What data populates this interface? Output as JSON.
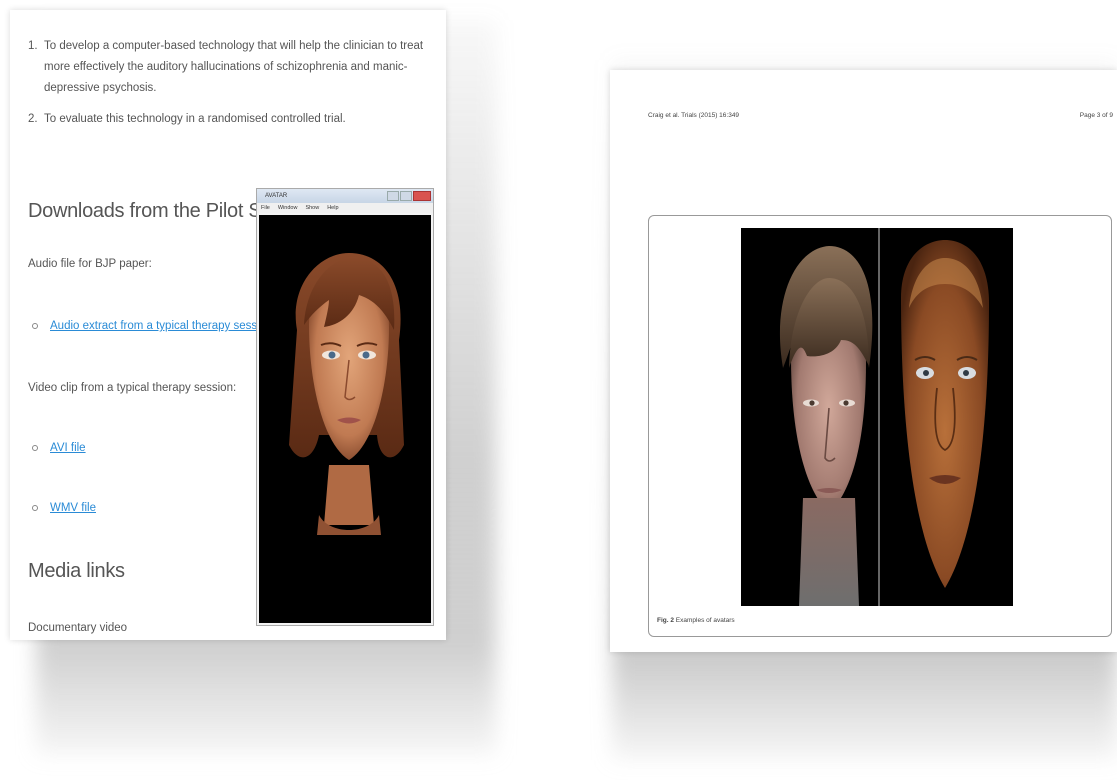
{
  "left_page": {
    "aims": [
      {
        "num": "1.",
        "text": "To develop a computer-based technology that will help the clinician to treat more effectively the auditory hallucinations of schizophrenia and manic-depressive psychosis."
      },
      {
        "num": "2.",
        "text": "To evaluate this technology in a randomised controlled trial."
      }
    ],
    "downloads_title": "Downloads from the Pilot Study",
    "audio_label": "Audio file for BJP paper:",
    "audio_link": "Audio extract from a typical therapy session",
    "video_label": "Video clip from a typical therapy session:",
    "avi_link": "AVI file",
    "wmv_link": "WMV file",
    "media_title": "Media links",
    "documentary_label": "Documentary video",
    "avatar_window": {
      "title": "AVATAR",
      "menu": [
        "File",
        "Window",
        "Show",
        "Help"
      ]
    }
  },
  "right_page": {
    "header_left": "Craig et al. Trials (2015) 16:349",
    "header_right": "Page 3 of 9",
    "caption_label": "Fig. 2",
    "caption_text": "Examples of avatars"
  },
  "colors": {
    "link": "#2a8bd6",
    "text": "#555555",
    "avatar_bg": "#000000"
  }
}
